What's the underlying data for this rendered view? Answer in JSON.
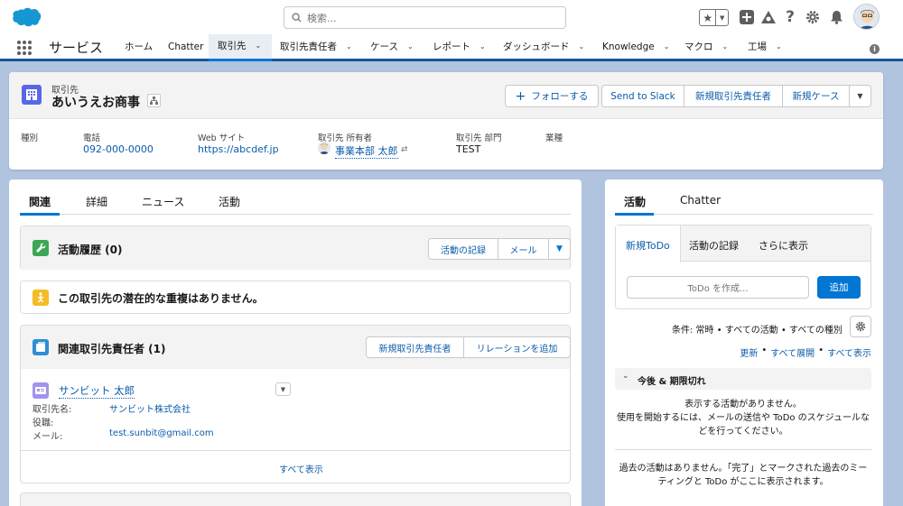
{
  "header": {
    "search_placeholder": "検索...",
    "icons": [
      "star-icon",
      "add-icon",
      "trailhead-icon",
      "help-icon",
      "setup-icon",
      "bell-icon"
    ]
  },
  "nav": {
    "app_name": "サービス",
    "items": [
      {
        "label": "ホーム",
        "chevron": false
      },
      {
        "label": "Chatter",
        "chevron": false
      },
      {
        "label": "取引先",
        "chevron": true,
        "active": true
      },
      {
        "label": "取引先責任者",
        "chevron": true
      },
      {
        "label": "ケース",
        "chevron": true
      },
      {
        "label": "レポート",
        "chevron": true
      },
      {
        "label": "ダッシュボード",
        "chevron": true
      },
      {
        "label": "Knowledge",
        "chevron": true
      },
      {
        "label": "マクロ",
        "chevron": true
      },
      {
        "label": "工場",
        "chevron": true
      }
    ]
  },
  "record": {
    "type": "取引先",
    "name": "あいうえお商事",
    "buttons": {
      "follow": "フォローする",
      "send_to_slack": "Send to Slack",
      "new_contact": "新規取引先責任者",
      "new_case": "新規ケース"
    },
    "fields": [
      {
        "label": "種別",
        "value": ""
      },
      {
        "label": "電話",
        "value": "092-000-0000"
      },
      {
        "label": "Web サイト",
        "value": "https://abcdef.jp"
      },
      {
        "label": "取引先 所有者",
        "value": "事業本部 太郎"
      },
      {
        "label": "取引先 部門",
        "value": "TEST"
      },
      {
        "label": "業種",
        "value": ""
      }
    ]
  },
  "left": {
    "tabs": [
      "関連",
      "詳細",
      "ニュース",
      "活動"
    ],
    "activity_history": {
      "title": "活動履歴 (0)",
      "log_button": "活動の記録",
      "mail_button": "メール"
    },
    "duplicates": {
      "message": "この取引先の潜在的な重複はありません。"
    },
    "related_contacts": {
      "title": "関連取引先責任者 (1)",
      "new_button": "新規取引先責任者",
      "add_relation_button": "リレーションを追加",
      "contact_name": "サンビット 太郎",
      "account_label": "取引先名:",
      "account_value": "サンビット株式会社",
      "title_label": "役職:",
      "email_label": "メール:",
      "email_value": "test.sunbit@gmail.com",
      "view_all": "すべて表示"
    }
  },
  "right": {
    "tabs": [
      "活動",
      "Chatter"
    ],
    "composer_tabs": [
      "新規ToDo",
      "活動の記録",
      "さらに表示"
    ],
    "todo_placeholder": "ToDo を作成...",
    "add_button": "追加",
    "filter_text": "条件: 常時 • すべての活動 • すべての種別",
    "links": [
      "更新",
      "すべて展開",
      "すべて表示"
    ],
    "upcoming_title": "今後 & 期限切れ",
    "upcoming_empty_1": "表示する活動がありません。",
    "upcoming_empty_2": "使用を開始するには、メールの送信や ToDo のスケジュールな",
    "upcoming_empty_3": "どを行ってください。",
    "past_empty_1": "過去の活動はありません。「完了」とマークされた過去のミー",
    "past_empty_2": "ティングと ToDo がここに表示されます。"
  },
  "colors": {
    "brand_blue": "#0176d3",
    "link_blue": "#0b5cab",
    "nav_underline": "#1b5297",
    "background": "#b0c4df",
    "account_icon": "#5867e8",
    "activity_icon": "#3ba755",
    "duplicate_icon": "#f4bc25",
    "contacts_icon": "#2e8ed6",
    "contact_card_icon": "#a094ed"
  }
}
